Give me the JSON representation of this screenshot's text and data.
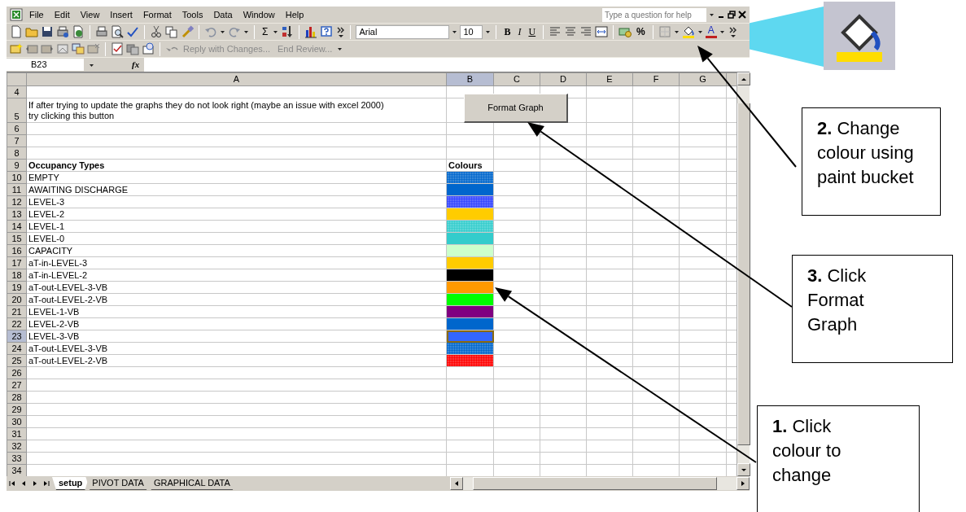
{
  "window": {
    "menu": [
      "File",
      "Edit",
      "View",
      "Insert",
      "Format",
      "Tools",
      "Data",
      "Window",
      "Help"
    ],
    "help_placeholder": "Type a question for help"
  },
  "formatting_toolbar": {
    "sum": "Σ",
    "font": "Arial",
    "size": "10",
    "styles": [
      "B",
      "I",
      "U"
    ],
    "percent": "%",
    "font_color": "A"
  },
  "reviewing_toolbar": {
    "buttons": [
      "Reply with Changes...",
      "End Review..."
    ]
  },
  "formula_bar": {
    "name_box": "B23",
    "fx": "fx"
  },
  "sheet": {
    "columns": [
      {
        "label": "A",
        "selected": false
      },
      {
        "label": "B",
        "selected": true
      },
      {
        "label": "C",
        "selected": false
      },
      {
        "label": "D",
        "selected": false
      },
      {
        "label": "E",
        "selected": false
      },
      {
        "label": "F",
        "selected": false
      },
      {
        "label": "G",
        "selected": false
      }
    ],
    "button": "Format Graph",
    "rows": [
      {
        "number": "4",
        "kind": "blank",
        "selected": false
      },
      {
        "number": "5",
        "kind": "note",
        "a": "If after trying to update the graphs they do not look right (maybe an issue with excel 2000) try clicking this button",
        "selected": false
      },
      {
        "number": "6",
        "kind": "blank",
        "selected": false
      },
      {
        "number": "7",
        "kind": "blank",
        "selected": false
      },
      {
        "number": "8",
        "kind": "blank",
        "selected": false
      },
      {
        "number": "9",
        "kind": "heading",
        "a": "Occupancy Types",
        "b": "Colours",
        "selected": false
      },
      {
        "number": "10",
        "kind": "colour",
        "a": "EMPTY",
        "color": "#0066cc",
        "dotted": true,
        "selected": false
      },
      {
        "number": "11",
        "kind": "colour",
        "a": "AWAITING DISCHARGE",
        "color": "#0066cc",
        "dotted": false,
        "selected": false
      },
      {
        "number": "12",
        "kind": "colour",
        "a": "LEVEL-3",
        "color": "#3344ff",
        "dotted": true,
        "selected": false
      },
      {
        "number": "13",
        "kind": "colour",
        "a": "LEVEL-2",
        "color": "#ffcc00",
        "dotted": false,
        "selected": false
      },
      {
        "number": "14",
        "kind": "colour",
        "a": "LEVEL-1",
        "color": "#33cccc",
        "dotted": true,
        "selected": false
      },
      {
        "number": "15",
        "kind": "colour",
        "a": "LEVEL-0",
        "color": "#33cccc",
        "dotted": false,
        "selected": false
      },
      {
        "number": "16",
        "kind": "colour",
        "a": "CAPACITY",
        "color": "#ccffcc",
        "dotted": false,
        "selected": false
      },
      {
        "number": "17",
        "kind": "colour",
        "a": "aT-in-LEVEL-3",
        "color": "#ffcc00",
        "dotted": false,
        "selected": false
      },
      {
        "number": "18",
        "kind": "colour",
        "a": "aT-in-LEVEL-2",
        "color": "#000000",
        "dotted": false,
        "selected": false
      },
      {
        "number": "19",
        "kind": "colour",
        "a": "aT-out-LEVEL-3-VB",
        "color": "#ff9900",
        "dotted": false,
        "selected": false
      },
      {
        "number": "20",
        "kind": "colour",
        "a": "aT-out-LEVEL-2-VB",
        "color": "#00ff00",
        "dotted": false,
        "selected": false
      },
      {
        "number": "21",
        "kind": "colour",
        "a": "LEVEL-1-VB",
        "color": "#800080",
        "dotted": false,
        "selected": false
      },
      {
        "number": "22",
        "kind": "colour",
        "a": "LEVEL-2-VB",
        "color": "#0066cc",
        "dotted": false,
        "selected": false
      },
      {
        "number": "23",
        "kind": "colour",
        "a": "LEVEL-3-VB",
        "color": "#3366ff",
        "dotted": false,
        "selected": true
      },
      {
        "number": "24",
        "kind": "colour",
        "a": "aT-out-LEVEL-3-VB",
        "color": "#0066cc",
        "dotted": true,
        "selected": false
      },
      {
        "number": "25",
        "kind": "colour",
        "a": "aT-out-LEVEL-2-VB",
        "color": "#ff0000",
        "dotted": true,
        "selected": false
      },
      {
        "number": "26",
        "kind": "blank",
        "selected": false
      },
      {
        "number": "27",
        "kind": "blank",
        "selected": false
      },
      {
        "number": "28",
        "kind": "blank",
        "selected": false
      },
      {
        "number": "29",
        "kind": "blank",
        "selected": false
      },
      {
        "number": "30",
        "kind": "blank",
        "selected": false
      },
      {
        "number": "31",
        "kind": "blank",
        "selected": false
      },
      {
        "number": "32",
        "kind": "blank",
        "selected": false
      },
      {
        "number": "33",
        "kind": "blank",
        "selected": false
      },
      {
        "number": "34",
        "kind": "blank",
        "selected": false
      }
    ]
  },
  "tabs": [
    {
      "label": "setup",
      "selected": true
    },
    {
      "label": "PIVOT DATA",
      "selected": false
    },
    {
      "label": "GRAPHICAL DATA",
      "selected": false
    }
  ],
  "annotations": [
    {
      "text": "**2.** Change colour using paint bucket"
    },
    {
      "text": "**3.** Click Format Graph"
    },
    {
      "text": "**1.** Click colour to change"
    }
  ]
}
